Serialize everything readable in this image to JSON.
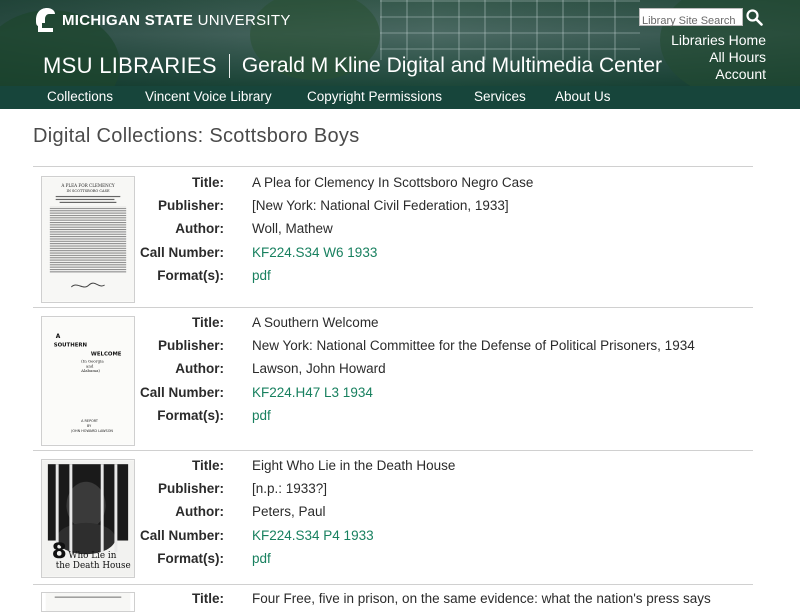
{
  "header": {
    "university_bold": "MICHIGAN STATE",
    "university_rest": " UNIVERSITY",
    "search_placeholder": "Library Site Search",
    "links": [
      "Libraries Home",
      "All Hours",
      "Account"
    ],
    "library_name": "MSU LIBRARIES",
    "center_name": "Gerald M Kline Digital and Multimedia Center"
  },
  "nav": [
    "Collections",
    "Vincent Voice Library",
    "Copyright Permissions",
    "Services",
    "About Us"
  ],
  "page_title": "Digital Collections: Scottsboro Boys",
  "field_labels": {
    "title": "Title:",
    "publisher": "Publisher:",
    "author": "Author:",
    "call_number": "Call Number:",
    "format": "Format(s):"
  },
  "records": [
    {
      "title": "A Plea for Clemency In Scottsboro Negro Case",
      "publisher": "[New York: National Civil Federation, 1933]",
      "author": "Woll, Mathew",
      "call_number": "KF224.S34 W6 1933",
      "format": "pdf",
      "thumb_text": [
        "A PLEA FOR CLEMENCY",
        "IN SCOTTSBORO CASE"
      ]
    },
    {
      "title": "A Southern Welcome",
      "publisher": "New York: National Committee for the Defense of Political Prisoners, 1934",
      "author": "Lawson, John Howard",
      "call_number": "KF224.H47 L3 1934",
      "format": "pdf",
      "thumb_text": [
        "A",
        "SOUTHERN",
        "WELCOME",
        "(In Georgia",
        "and",
        "Alabama)",
        "A REPORT",
        "BY",
        "JOHN HOWARD LAWSON"
      ]
    },
    {
      "title": "Eight Who Lie in the Death House",
      "publisher": "[n.p.: 1933?]",
      "author": "Peters, Paul",
      "call_number": "KF224.S34 P4 1933",
      "format": "pdf",
      "thumb_text": [
        "8",
        "Who Lie in",
        "the Death House"
      ]
    },
    {
      "title": "Four Free, five in prison, on the same evidence: what the nation's press says"
    }
  ]
}
